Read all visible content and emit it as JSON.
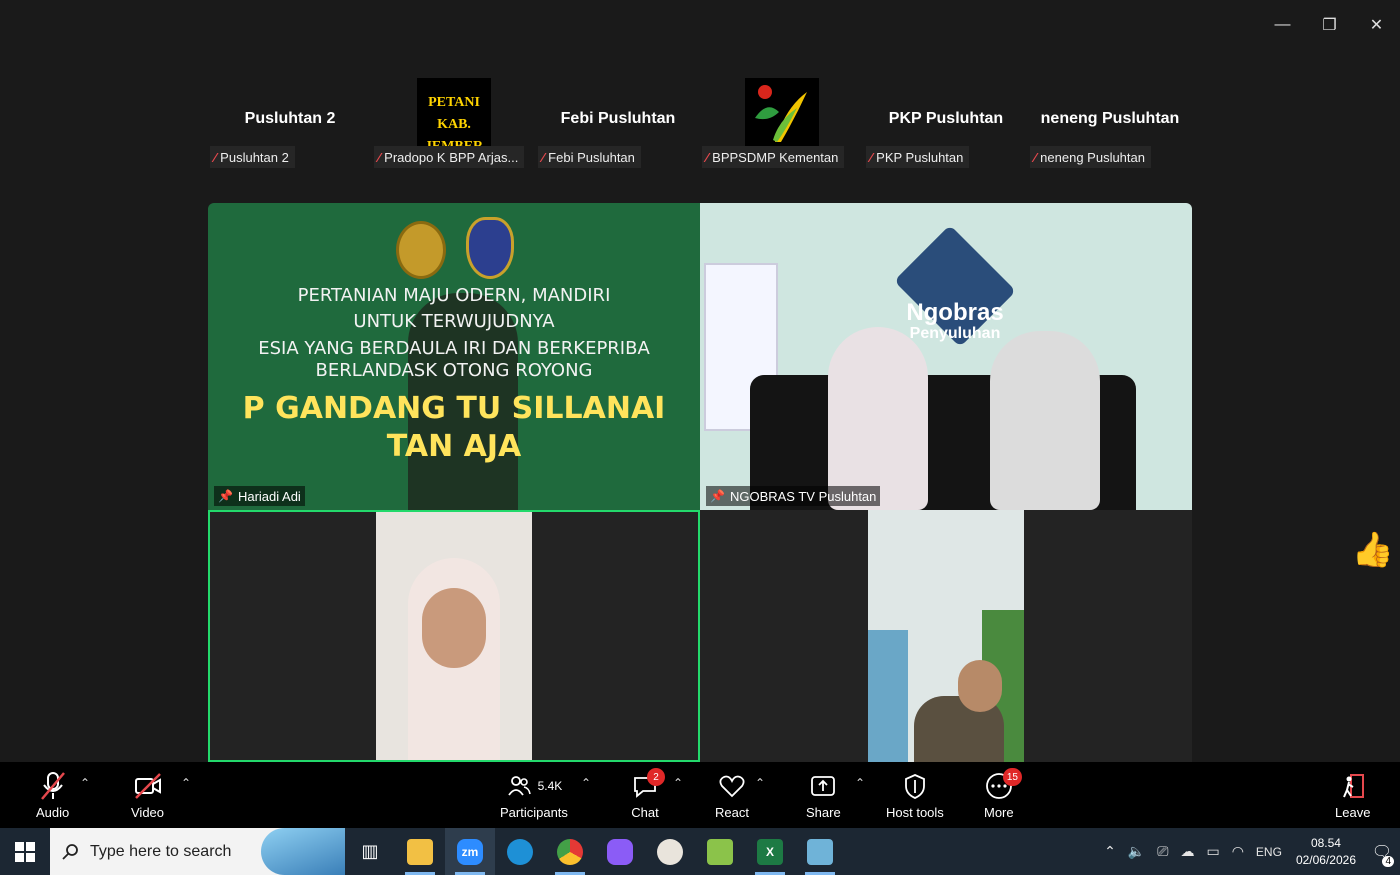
{
  "window": {
    "minimize": "—",
    "restore": "❐",
    "close": "✕"
  },
  "strip": [
    {
      "name": "Pusluhtan 2",
      "label": "Pusluhtan 2",
      "has_logo": false
    },
    {
      "name": "",
      "label": "Pradopo K BPP Arjas...",
      "logo_text": [
        "PETANI",
        "KAB. JEMBER"
      ]
    },
    {
      "name": "Febi Pusluhtan",
      "label": "Febi Pusluhtan"
    },
    {
      "name": "",
      "label": "BPPSDMP Kementan",
      "logo": "bppsdmp-logo"
    },
    {
      "name": "PKP Pusluhtan",
      "label": "PKP Pusluhtan"
    },
    {
      "name": "neneng Pusluhtan",
      "label": "neneng Pusluhtan"
    }
  ],
  "tiles": {
    "tile1": {
      "label": "Hariadi Adi",
      "banner": [
        "PERTANIAN MAJU   ODERN, MANDIRI",
        "UNTUK TERWUJUDNYA",
        "ESIA YANG BERDAULA    IRI DAN BERKEPRIBA",
        "BERLANDASK    OTONG ROYONG",
        "P GANDANG    TU SILLANAI",
        "TAN    AJA"
      ]
    },
    "tile2": {
      "label": "NGOBRAS TV Pusluhtan",
      "show_title": "Ngobras",
      "show_subtitle": "Penyuluhan"
    },
    "tile3": {
      "label": ""
    },
    "tile4": {
      "label": ""
    }
  },
  "toolbar": {
    "audio": "Audio",
    "video": "Video",
    "participants": "Participants",
    "participants_count": "5.4K",
    "chat": "Chat",
    "chat_badge": "2",
    "react": "React",
    "share": "Share",
    "host_tools": "Host tools",
    "more": "More",
    "more_badge": "15",
    "leave": "Leave"
  },
  "taskbar": {
    "search_placeholder": "Type here to search",
    "lang": "ENG",
    "time": "08.54",
    "date": "02/06/2026",
    "notif_count": "4"
  },
  "colors": {
    "speaker_border": "#23d96b",
    "badge": "#e02828",
    "taskbar": "#1c2733"
  }
}
